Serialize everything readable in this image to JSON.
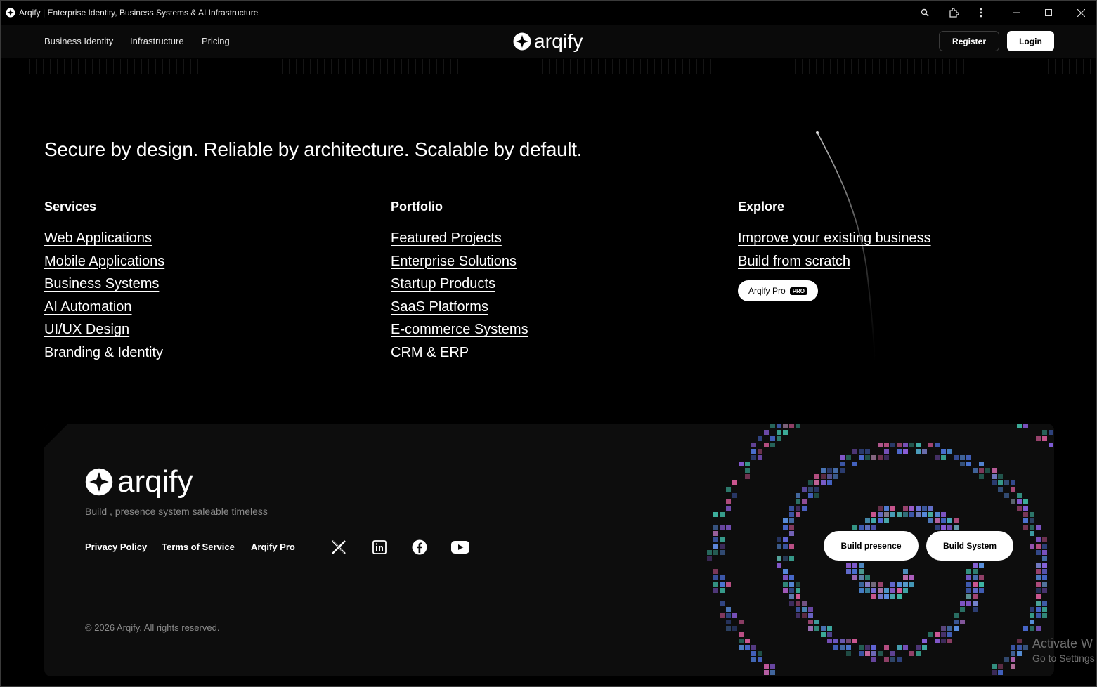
{
  "window": {
    "title": "Arqify | Enterprise Identity, Business Systems & AI Infrastructure"
  },
  "nav": {
    "links": [
      "Business Identity",
      "Infrastructure",
      "Pricing"
    ],
    "brand": "arqify",
    "register": "Register",
    "login": "Login"
  },
  "hero": {
    "tagline": "Secure by design. Reliable by architecture. Scalable by default."
  },
  "columns": {
    "services": {
      "heading": "Services",
      "items": [
        "Web Applications",
        "Mobile Applications",
        "Business Systems",
        "AI Automation",
        "UI/UX Design",
        "Branding & Identity"
      ]
    },
    "portfolio": {
      "heading": "Portfolio",
      "items": [
        "Featured Projects",
        "Enterprise Solutions",
        "Startup Products",
        "SaaS Platforms",
        "E-commerce Systems",
        "CRM & ERP"
      ]
    },
    "explore": {
      "heading": "Explore",
      "items": [
        "Improve your existing business",
        "Build from scratch"
      ],
      "pro_label": "Arqify Pro",
      "pro_badge": "PRO"
    }
  },
  "footer": {
    "brand": "arqify",
    "subtitle": "Build , presence system saleable timeless",
    "links": [
      "Privacy Policy",
      "Terms of Service",
      "Arqify Pro"
    ],
    "social": [
      "x-icon",
      "linkedin-icon",
      "facebook-icon",
      "youtube-icon"
    ],
    "buttons": [
      "Build presence",
      "Build System"
    ],
    "copyright": "© 2026 Arqify. All rights reserved."
  },
  "os_overlay": {
    "line1": "Activate W",
    "line2": "Go to Settings"
  },
  "colors": {
    "background": "#000000",
    "footer_card": "#0d0d0d",
    "spiral": [
      "#4a6cd4",
      "#8a5cd8",
      "#3fb7a3",
      "#d95c9a",
      "#5a8fe0"
    ]
  }
}
